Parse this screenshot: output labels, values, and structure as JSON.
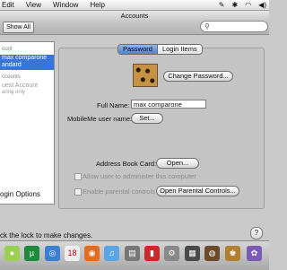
{
  "menubar": {
    "items": [
      "Edit",
      "View",
      "Window",
      "Help"
    ],
    "status_icons": [
      "script-icon",
      "bluetooth-icon",
      "wifi-icon",
      "volume-icon"
    ]
  },
  "window": {
    "title": "Accounts"
  },
  "toolbar": {
    "show_all": "Show All",
    "search_placeholder": ""
  },
  "sidebar": {
    "section_my": "ount",
    "selected_account": {
      "name": "max comparone",
      "type": "andard"
    },
    "section_other": "ccounts",
    "guest": {
      "name": "uest Account",
      "note": "aring only"
    },
    "login_options": "ogin Options"
  },
  "tabs": {
    "password": "Password",
    "login_items": "Login Items"
  },
  "account": {
    "change_password": "Change Password...",
    "full_name_label": "Full Name:",
    "full_name_value": "max comparone",
    "mobileme_label": "MobileMe user name:",
    "mobileme_button": "Set...",
    "address_book_label": "Address Book Card:",
    "address_book_button": "Open...",
    "admin_label": "Allow user to administer this computer",
    "parental_label": "Enable parental controls",
    "parental_button": "Open Parental Controls..."
  },
  "footer": {
    "lock_text": "ck the lock to make changes.",
    "help": "?"
  },
  "colors": {
    "selection": "#3875d7",
    "tab_active": "#5a92d8"
  }
}
